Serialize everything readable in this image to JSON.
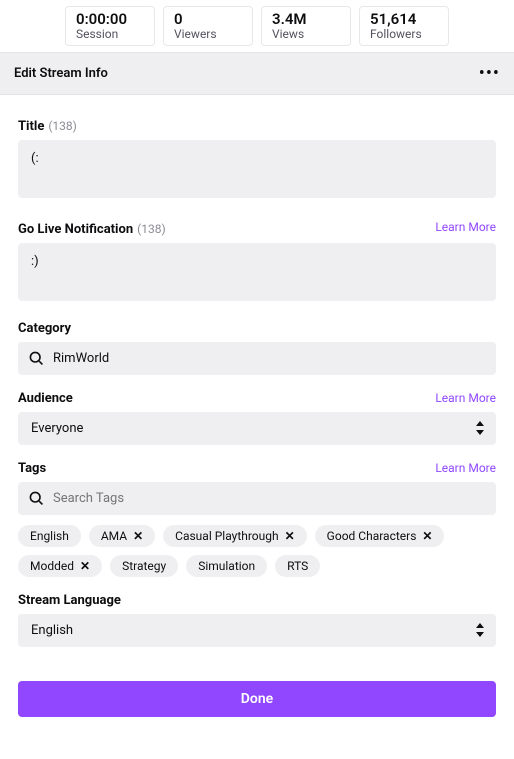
{
  "stats": {
    "session": {
      "value": "0:00:00",
      "label": "Session"
    },
    "viewers": {
      "value": "0",
      "label": "Viewers"
    },
    "views": {
      "value": "3.4M",
      "label": "Views"
    },
    "followers": {
      "value": "51,614",
      "label": "Followers"
    }
  },
  "panel": {
    "title": "Edit Stream Info"
  },
  "title_field": {
    "label": "Title",
    "count": "(138)",
    "value": "(:"
  },
  "notification_field": {
    "label": "Go Live Notification",
    "count": "(138)",
    "learn_more": "Learn More",
    "value": ":)"
  },
  "category_field": {
    "label": "Category",
    "value": "RimWorld"
  },
  "audience_field": {
    "label": "Audience",
    "learn_more": "Learn More",
    "value": "Everyone"
  },
  "tags_field": {
    "label": "Tags",
    "learn_more": "Learn More",
    "placeholder": "Search Tags",
    "tags": [
      {
        "label": "English",
        "removable": false
      },
      {
        "label": "AMA",
        "removable": true
      },
      {
        "label": "Casual Playthrough",
        "removable": true
      },
      {
        "label": "Good Characters",
        "removable": true
      },
      {
        "label": "Modded",
        "removable": true
      },
      {
        "label": "Strategy",
        "removable": false
      },
      {
        "label": "Simulation",
        "removable": false
      },
      {
        "label": "RTS",
        "removable": false
      }
    ]
  },
  "language_field": {
    "label": "Stream Language",
    "value": "English"
  },
  "done_label": "Done"
}
